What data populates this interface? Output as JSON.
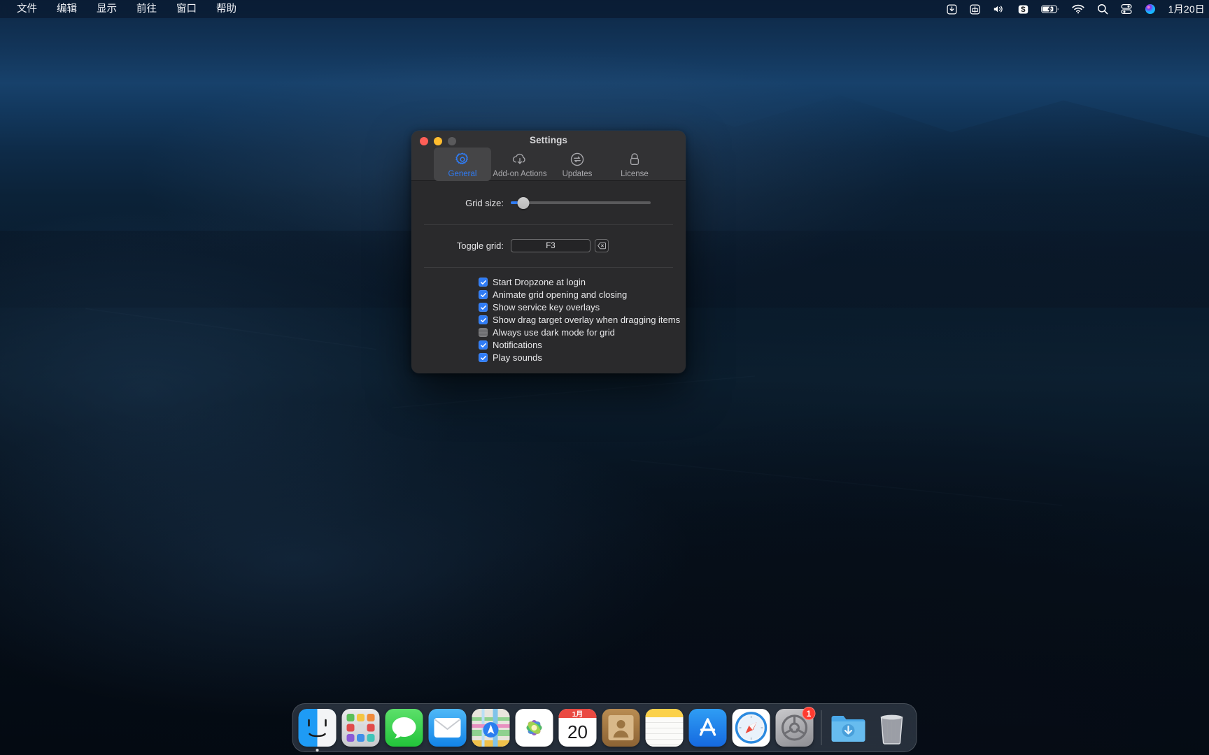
{
  "menubar": {
    "left_items": [
      {
        "label": "文件",
        "name": "menu-file"
      },
      {
        "label": "编辑",
        "name": "menu-edit"
      },
      {
        "label": "显示",
        "name": "menu-view"
      },
      {
        "label": "前往",
        "name": "menu-go"
      },
      {
        "label": "窗口",
        "name": "menu-window"
      },
      {
        "label": "帮助",
        "name": "menu-help"
      }
    ],
    "status_items": [
      {
        "icon": "download-icon",
        "label": ""
      },
      {
        "icon": "input-source-icon",
        "label": "中"
      },
      {
        "icon": "volume-icon",
        "label": ""
      },
      {
        "icon": "snipaste-icon",
        "label": "S"
      },
      {
        "icon": "battery-charging-icon",
        "label": ""
      },
      {
        "icon": "wifi-icon",
        "label": ""
      },
      {
        "icon": "spotlight-search-icon",
        "label": ""
      },
      {
        "icon": "control-center-icon",
        "label": ""
      },
      {
        "icon": "siri-icon",
        "label": ""
      }
    ],
    "clock": "1月20日"
  },
  "window": {
    "title": "Settings",
    "traffic_lights": [
      "close",
      "minimize",
      "zoom"
    ],
    "toolbar_tabs": [
      {
        "label": "General",
        "icon": "gear-icon",
        "selected": true
      },
      {
        "label": "Add-on Actions",
        "icon": "cloud-download-icon",
        "selected": false
      },
      {
        "label": "Updates",
        "icon": "refresh-circle-icon",
        "selected": false
      },
      {
        "label": "License",
        "icon": "lock-icon",
        "selected": false
      }
    ],
    "general": {
      "grid_size": {
        "label": "Grid size:",
        "value_percent": 9
      },
      "toggle_grid": {
        "label": "Toggle grid:",
        "shortcut": "F3",
        "clear_icon": "delete-left-icon"
      },
      "checkboxes": [
        {
          "label": "Start Dropzone at login",
          "checked": true
        },
        {
          "label": "Animate grid opening and closing",
          "checked": true
        },
        {
          "label": "Show service key overlays",
          "checked": true
        },
        {
          "label": "Show drag target overlay when dragging items",
          "checked": true
        },
        {
          "label": "Always use dark mode for grid",
          "checked": false
        },
        {
          "label": "Notifications",
          "checked": true
        },
        {
          "label": "Play sounds",
          "checked": true
        }
      ]
    }
  },
  "dock": {
    "items": [
      {
        "name": "dock-finder",
        "label": "Finder",
        "running": true
      },
      {
        "name": "dock-launchpad",
        "label": "Launchpad",
        "running": false
      },
      {
        "name": "dock-messages",
        "label": "Messages",
        "running": false
      },
      {
        "name": "dock-mail",
        "label": "Mail",
        "running": false
      },
      {
        "name": "dock-maps",
        "label": "Maps",
        "running": false
      },
      {
        "name": "dock-photos",
        "label": "Photos",
        "running": false
      },
      {
        "name": "dock-calendar",
        "label": "Calendar",
        "running": false,
        "month": "1月",
        "day": "20"
      },
      {
        "name": "dock-contacts",
        "label": "Contacts",
        "running": false
      },
      {
        "name": "dock-notes",
        "label": "Notes",
        "running": false
      },
      {
        "name": "dock-appstore",
        "label": "App Store",
        "running": false
      },
      {
        "name": "dock-safari",
        "label": "Safari",
        "running": false
      },
      {
        "name": "dock-system-preferences",
        "label": "System Preferences",
        "running": false,
        "badge": "1"
      },
      {
        "name": "dock-downloads",
        "label": "Downloads",
        "running": false
      },
      {
        "name": "dock-trash",
        "label": "Trash",
        "running": false
      }
    ]
  },
  "colors": {
    "accent": "#2f7cf6",
    "window_bg": "#2a2a2c",
    "toolbar_bg": "#323234",
    "badge_red": "#ff3b30"
  }
}
